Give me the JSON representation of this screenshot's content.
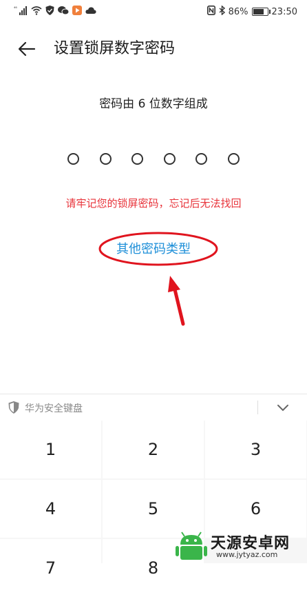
{
  "status_bar": {
    "signal_text": "⁴⁶",
    "battery_percent": "86%",
    "time": "23:50",
    "battery_level": 0.86
  },
  "header": {
    "back_icon": "arrow-left-icon",
    "title": "设置锁屏数字密码"
  },
  "prompt": "密码由 6 位数字组成",
  "pin_length": 6,
  "warning": "请牢记您的锁屏密码，忘记后无法找回",
  "other_types_link": "其他密码类型",
  "keyboard": {
    "label": "华为安全键盘",
    "shield_icon": "shield-icon",
    "collapse_icon": "chevron-down-icon",
    "keys": [
      "1",
      "2",
      "3",
      "4",
      "5",
      "6",
      "7",
      "8"
    ]
  },
  "watermark": {
    "title": "天源安卓网",
    "url": "www.jytyaz.com"
  },
  "colors": {
    "warning": "#e8333a",
    "link": "#1e8fd8",
    "annotation": "#e0141e"
  }
}
